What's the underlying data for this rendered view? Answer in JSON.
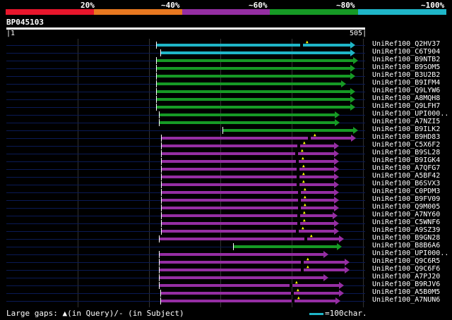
{
  "legend": {
    "colors": [
      "#e8162c",
      "#e87820",
      "#952ea3",
      "#169a25",
      "#1fb6c8"
    ],
    "labels": [
      "20%",
      "~40%",
      "~60%",
      "~80%",
      "~100%"
    ]
  },
  "query": {
    "id": "BP045103",
    "start": "1",
    "end": "505"
  },
  "footer": {
    "gaps_label": "Large gaps: ▲(in Query)/- (in Subject)",
    "scale_label": "=100char."
  },
  "hits": [
    {
      "name": "UniRef100_Q2HV37",
      "color": "#1fb6c8",
      "s": 222,
      "e": 497,
      "m": [
        435
      ]
    },
    {
      "name": "UniRef100_C6T904",
      "color": "#1fb6c8",
      "s": 228,
      "e": 497,
      "m": []
    },
    {
      "name": "UniRef100_B9NTB2",
      "color": "#169a25",
      "s": 222,
      "e": 501,
      "m": []
    },
    {
      "name": "UniRef100_B9SOM5",
      "color": "#169a25",
      "s": 222,
      "e": 497,
      "m": []
    },
    {
      "name": "UniRef100_B3U2B2",
      "color": "#169a25",
      "s": 222,
      "e": 497,
      "m": []
    },
    {
      "name": "UniRef100_B9IFM4",
      "color": "#169a25",
      "s": 222,
      "e": 484,
      "m": []
    },
    {
      "name": "UniRef100_Q9LYW6",
      "color": "#169a25",
      "s": 222,
      "e": 497,
      "m": []
    },
    {
      "name": "UniRef100_A8MQH8",
      "color": "#169a25",
      "s": 222,
      "e": 497,
      "m": []
    },
    {
      "name": "UniRef100_Q9LFH7",
      "color": "#169a25",
      "s": 222,
      "e": 497,
      "m": []
    },
    {
      "name": "UniRef100_UPI000..",
      "color": "#169a25",
      "s": 226,
      "e": 475,
      "m": []
    },
    {
      "name": "UniRef100_A7NZI5",
      "color": "#169a25",
      "s": 226,
      "e": 475,
      "m": []
    },
    {
      "name": "UniRef100_B9ILK2",
      "color": "#169a25",
      "s": 316,
      "e": 501,
      "m": []
    },
    {
      "name": "UniRef100_B9HD83",
      "color": "#952ea3",
      "s": 229,
      "e": 498,
      "m": [
        446
      ]
    },
    {
      "name": "UniRef100_C5X6F2",
      "color": "#952ea3",
      "s": 229,
      "e": 474,
      "m": [
        431
      ]
    },
    {
      "name": "UniRef100_B9SL28",
      "color": "#952ea3",
      "s": 229,
      "e": 474,
      "m": [
        428
      ]
    },
    {
      "name": "UniRef100_B9IGK4",
      "color": "#952ea3",
      "s": 229,
      "e": 474,
      "m": [
        429
      ]
    },
    {
      "name": "UniRef100_A7QFG7",
      "color": "#952ea3",
      "s": 229,
      "e": 474,
      "m": [
        430
      ]
    },
    {
      "name": "UniRef100_A5BF42",
      "color": "#952ea3",
      "s": 229,
      "e": 474,
      "m": [
        430
      ]
    },
    {
      "name": "UniRef100_B6SVX3",
      "color": "#952ea3",
      "s": 229,
      "e": 474,
      "m": [
        430
      ]
    },
    {
      "name": "UniRef100_C0PDM3",
      "color": "#952ea3",
      "s": 229,
      "e": 474,
      "m": [
        432
      ]
    },
    {
      "name": "UniRef100_B9FV09",
      "color": "#952ea3",
      "s": 229,
      "e": 474,
      "m": [
        432
      ]
    },
    {
      "name": "UniRef100_Q9M005",
      "color": "#952ea3",
      "s": 229,
      "e": 474,
      "m": [
        432
      ]
    },
    {
      "name": "UniRef100_A7NY60",
      "color": "#952ea3",
      "s": 229,
      "e": 472,
      "m": [
        431
      ]
    },
    {
      "name": "UniRef100_C5WNF6",
      "color": "#952ea3",
      "s": 229,
      "e": 474,
      "m": [
        431
      ]
    },
    {
      "name": "UniRef100_A9SZ39",
      "color": "#952ea3",
      "s": 229,
      "e": 474,
      "m": [
        429
      ]
    },
    {
      "name": "UniRef100_B9GN28",
      "color": "#952ea3",
      "s": 226,
      "e": 481,
      "m": [
        441
      ]
    },
    {
      "name": "UniRef100_B8B6A6",
      "color": "#169a25",
      "s": 331,
      "e": 478,
      "m": []
    },
    {
      "name": "UniRef100_UPI000..",
      "color": "#952ea3",
      "s": 226,
      "e": 459,
      "m": []
    },
    {
      "name": "UniRef100_Q9C6R5",
      "color": "#952ea3",
      "s": 226,
      "e": 489,
      "m": [
        436
      ]
    },
    {
      "name": "UniRef100_Q9C6F6",
      "color": "#952ea3",
      "s": 226,
      "e": 489,
      "m": [
        436
      ]
    },
    {
      "name": "UniRef100_A7PJ20",
      "color": "#952ea3",
      "s": 226,
      "e": 459,
      "m": []
    },
    {
      "name": "UniRef100_B9RJV6",
      "color": "#952ea3",
      "s": 226,
      "e": 481,
      "m": [
        420
      ]
    },
    {
      "name": "UniRef100_A5B0M5",
      "color": "#952ea3",
      "s": 228,
      "e": 481,
      "m": [
        422
      ]
    },
    {
      "name": "UniRef100_A7NUN6",
      "color": "#952ea3",
      "s": 228,
      "e": 476,
      "m": [
        423
      ]
    }
  ]
}
